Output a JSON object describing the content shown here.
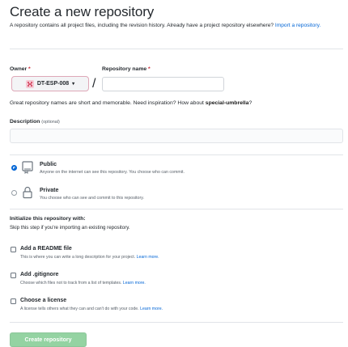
{
  "header": {
    "title": "Create a new repository",
    "subtitle": "A repository contains all project files, including the revision history. Already have a project repository elsewhere?",
    "import_link": "Import a repository."
  },
  "owner": {
    "label": "Owner",
    "required_mark": "*",
    "value": "DT-ESP-008",
    "caret": "▾"
  },
  "repo_name": {
    "label": "Repository name",
    "required_mark": "*",
    "value": ""
  },
  "slash": "/",
  "hint": {
    "text": "Great repository names are short and memorable. Need inspiration? How about",
    "suggestion": "special-umbrella",
    "end": "?"
  },
  "description": {
    "label": "Description",
    "optional": "(optional)",
    "value": ""
  },
  "visibility": {
    "public": {
      "title": "Public",
      "desc": "Anyone on the internet can see this repository. You choose who can commit.",
      "selected": true
    },
    "private": {
      "title": "Private",
      "desc": "You choose who can see and commit to this repository.",
      "selected": false
    }
  },
  "init": {
    "title": "Initialize this repository with:",
    "subtitle": "Skip this step if you're importing an existing repository.",
    "readme": {
      "title": "Add a README file",
      "desc": "This is where you can write a long description for your project.",
      "link": "Learn more."
    },
    "gitignore": {
      "title": "Add .gitignore",
      "desc": "Choose which files not to track from a list of templates.",
      "link": "Learn more."
    },
    "license": {
      "title": "Choose a license",
      "desc": "A license tells others what they can and can't do with your code.",
      "link": "Learn more."
    }
  },
  "submit": {
    "label": "Create repository"
  },
  "colors": {
    "link": "#0366d6",
    "required": "#cb2431",
    "create_button": "#94d3a2",
    "radio_selected": "#0366d6"
  }
}
